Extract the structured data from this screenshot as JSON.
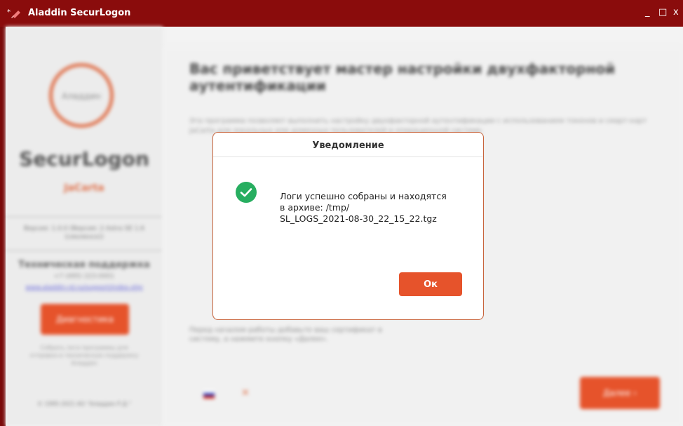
{
  "window": {
    "title": "Aladdin SecurLogon",
    "controls": {
      "minimize": "_",
      "maximize": "□",
      "close": "x"
    }
  },
  "sidebar": {
    "logo_text": "Аладдин",
    "brand": "SecurLogon",
    "sub_brand": "JaCarta",
    "version": "Версия: 1.0.0 (Версия: 2 Astra SE 1.6 (смоленск))",
    "support_title": "Техническая поддержка",
    "phone": "+7 (495) 223-0001",
    "link": "www.aladdin-rd.ru/support/index.php",
    "diagnostics_button": "Диагностика",
    "note": "Собрать логи программы для отправки в техническую поддержку Аладдин",
    "copyright": "© 1995-2021 АО \"Аладдин Р.Д.\""
  },
  "main": {
    "welcome_title": "Вас приветствует мастер настройки двухфакторной аутентификации",
    "intro_text": "Эта программа позволяет выполнить настройку двухфакторной аутентификации с использованием токенов и смарт-карт JaCarta для локальных или доменных пользователей в операционной системе.",
    "hint_text": "Перед началом работы добавьте ваш сертификат в систему, а нажмите кнопку «Далее».",
    "next_button": "Далее  ›"
  },
  "dialog": {
    "title": "Уведомление",
    "message_lines": [
      "Логи успешно собраны и находятся",
      "в архиве: /tmp/",
      "SL_LOGS_2021-08-30_22_15_22.tgz"
    ],
    "ok_button": "Ок",
    "icon": "check-circle-icon"
  },
  "colors": {
    "titlebar": "#8a0c0c",
    "accent": "#e6532b",
    "success": "#27ae60"
  }
}
